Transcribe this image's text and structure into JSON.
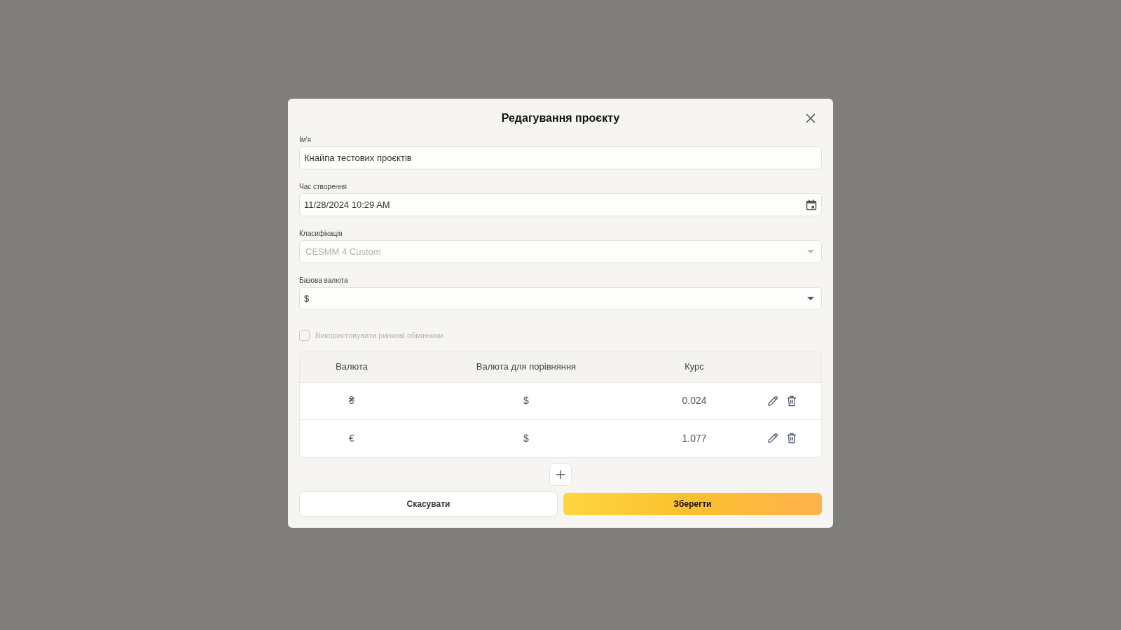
{
  "dialog": {
    "title": "Редагування проєкту",
    "fields": [
      {
        "kind": "text",
        "label": "Ім'я",
        "value": "Кнайпа тестових проєктів",
        "disabled": false
      },
      {
        "kind": "date",
        "label": "Час створення",
        "value": "11/28/2024 10:29 AM",
        "disabled": false
      },
      {
        "kind": "select",
        "label": "Класифікація",
        "value": "CESMM 4 Custom",
        "disabled": true
      },
      {
        "kind": "select",
        "label": "Базова валюта",
        "value": "$",
        "disabled": false
      }
    ],
    "checkbox": {
      "label": "Використовувати ринкові обмінники",
      "checked": false,
      "disabled": true
    },
    "table": {
      "columns": [
        "Валюта",
        "Валюта для порівняння",
        "Курс"
      ],
      "rows": [
        {
          "currency": "₴",
          "compare": "$",
          "rate": "0.024"
        },
        {
          "currency": "€",
          "compare": "$",
          "rate": "1.077"
        }
      ]
    },
    "buttons": {
      "cancel": "Скасувати",
      "save": "Зберегти"
    }
  }
}
